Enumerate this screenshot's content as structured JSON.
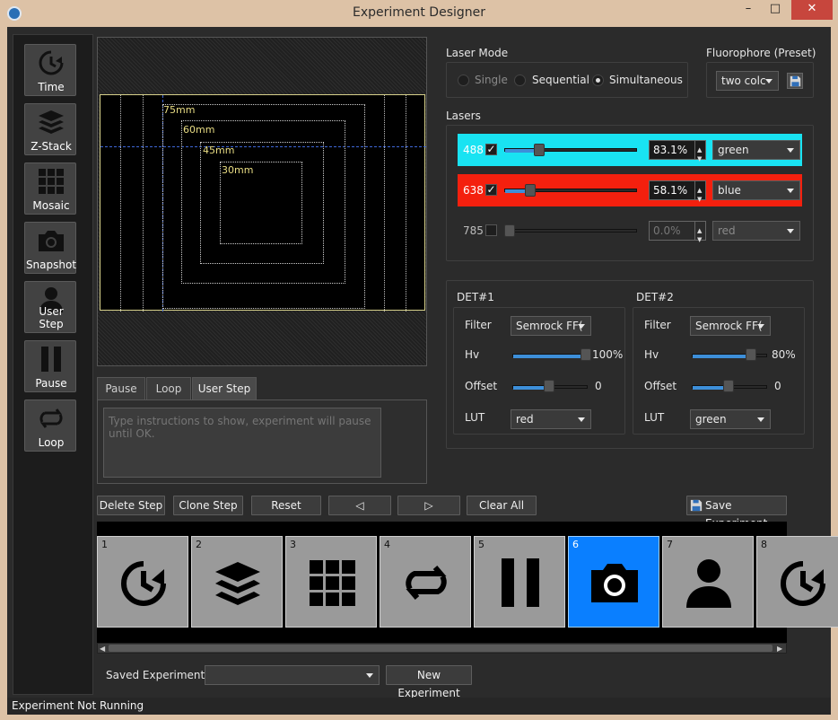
{
  "window": {
    "title": "Experiment Designer",
    "minimize": "–",
    "maximize": "□",
    "close": "✕"
  },
  "toolbar": [
    {
      "label": "Time",
      "icon": "clock-icon"
    },
    {
      "label": "Z-Stack",
      "icon": "layers-icon"
    },
    {
      "label": "Mosaic",
      "icon": "grid-icon"
    },
    {
      "label": "Snapshot",
      "icon": "camera-icon"
    },
    {
      "label": "User Step",
      "icon": "user-icon"
    },
    {
      "label": "Pause",
      "icon": "pause-icon"
    },
    {
      "label": "Loop",
      "icon": "loop-icon"
    }
  ],
  "preview": {
    "labels": [
      "75mm",
      "60mm",
      "45mm",
      "30mm"
    ]
  },
  "tabs": {
    "pause": "Pause",
    "loop": "Loop",
    "user_step": "User Step",
    "active": "User Step"
  },
  "user_step": {
    "placeholder": "Type instructions to show, experiment will pause until OK."
  },
  "laser_mode": {
    "title": "Laser Mode",
    "options": [
      "Single",
      "Sequential",
      "Simultaneous"
    ],
    "selected": "Simultaneous"
  },
  "fluorophore": {
    "title": "Fluorophore (Preset)",
    "value": "two colc",
    "save_icon": "save-icon"
  },
  "lasers": {
    "title": "Lasers",
    "rows": [
      {
        "wavelength": "488",
        "checked": true,
        "power": "83.1%",
        "level": 0.831,
        "color": "green",
        "bg": "#19e3f2"
      },
      {
        "wavelength": "638",
        "checked": true,
        "power": "58.1%",
        "level": 0.581,
        "color": "blue",
        "bg": "#f4200e"
      },
      {
        "wavelength": "785",
        "checked": false,
        "power": "0.0%",
        "level": 0.0,
        "color": "red",
        "bg": "#2b2b2b"
      }
    ]
  },
  "detectors": [
    {
      "title": "DET#1",
      "filter_label": "Filter",
      "filter": "Semrock FF(",
      "hv_label": "Hv",
      "hv": "100%",
      "hv_level": 1.0,
      "offset_label": "Offset",
      "offset": "0",
      "offset_level": 0.5,
      "lut_label": "LUT",
      "lut": "red"
    },
    {
      "title": "DET#2",
      "filter_label": "Filter",
      "filter": "Semrock FF(",
      "hv_label": "Hv",
      "hv": "80%",
      "hv_level": 0.8,
      "offset_label": "Offset",
      "offset": "0",
      "offset_level": 0.5,
      "lut_label": "LUT",
      "lut": "green"
    }
  ],
  "actions": {
    "delete": "Delete Step",
    "clone": "Clone Step",
    "reset": "Reset",
    "prev": "◁",
    "next": "▷",
    "clear": "Clear All",
    "save": "Save Experiment"
  },
  "steps": [
    {
      "num": "1",
      "icon": "clock-icon"
    },
    {
      "num": "2",
      "icon": "layers-icon"
    },
    {
      "num": "3",
      "icon": "grid-icon"
    },
    {
      "num": "4",
      "icon": "loop-icon"
    },
    {
      "num": "5",
      "icon": "pause-icon"
    },
    {
      "num": "6",
      "icon": "camera-icon",
      "selected": true
    },
    {
      "num": "7",
      "icon": "user-icon"
    },
    {
      "num": "8",
      "icon": "clock-icon"
    }
  ],
  "saved": {
    "label": "Saved Experiments",
    "value": "",
    "new_button": "New Experiment"
  },
  "status": {
    "text": "Experiment Not Running"
  }
}
